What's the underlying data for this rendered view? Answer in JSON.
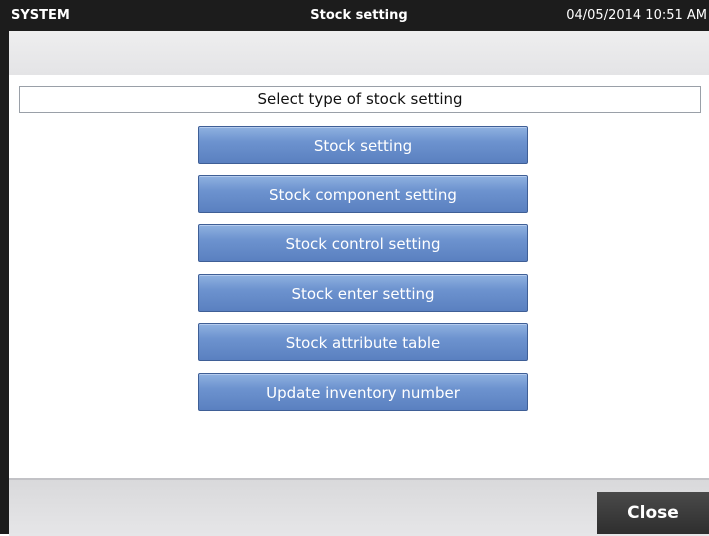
{
  "titlebar": {
    "system_label": "SYSTEM",
    "title": "Stock setting",
    "datetime": "04/05/2014 10:51 AM"
  },
  "header": {
    "prompt": "Select type of stock setting"
  },
  "menu": {
    "items": [
      {
        "label": "Stock setting"
      },
      {
        "label": "Stock component setting"
      },
      {
        "label": "Stock control setting"
      },
      {
        "label": "Stock enter setting"
      },
      {
        "label": "Stock attribute table"
      },
      {
        "label": "Update inventory number"
      }
    ]
  },
  "footer": {
    "close_label": "Close"
  },
  "colors": {
    "button_blue": "#6d93cf",
    "titlebar_bg": "#1c1c1c",
    "close_bg": "#3a3a3a"
  }
}
